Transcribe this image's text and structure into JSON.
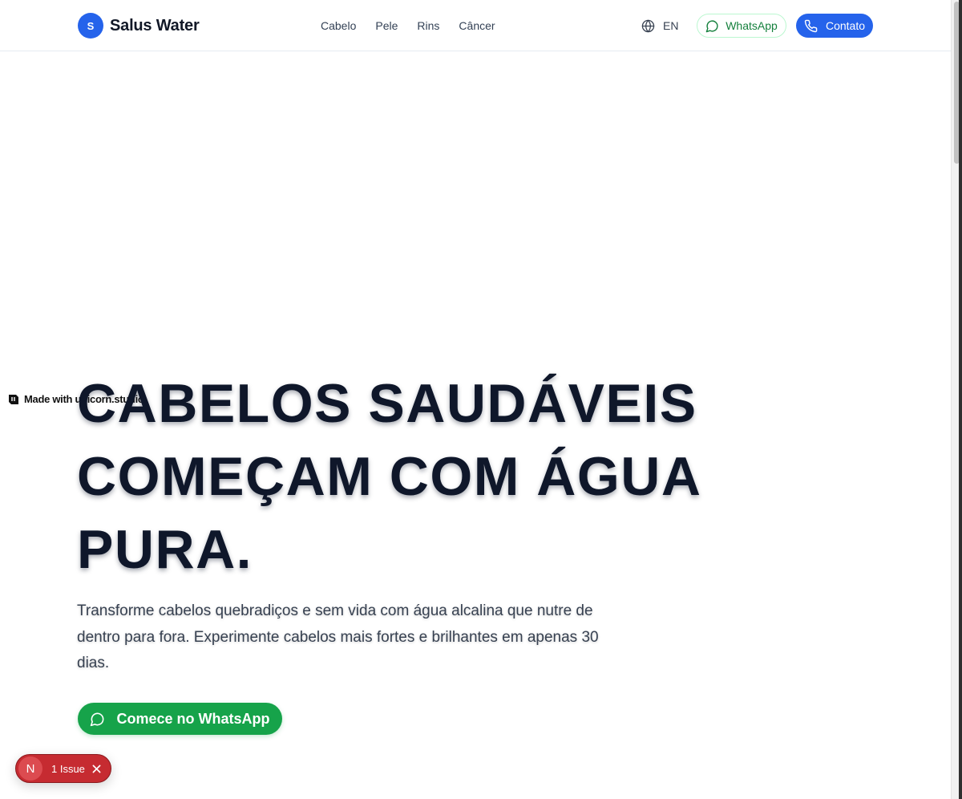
{
  "header": {
    "logo_letter": "S",
    "logo_text": "Salus Water",
    "nav": [
      {
        "label": "Cabelo"
      },
      {
        "label": "Pele"
      },
      {
        "label": "Rins"
      },
      {
        "label": "Câncer"
      }
    ],
    "language": {
      "label": "EN",
      "icon": "globe-icon"
    },
    "whatsapp_label": "WhatsApp",
    "contact_label": "Contato"
  },
  "hero": {
    "title_lines": [
      "CABELOS SAUDÁVEIS",
      "COMEÇAM COM ÁGUA",
      "PURA."
    ],
    "subtitle": "Transforme cabelos quebradiços e sem vida com água alcalina que nutre de dentro para fora. Experimente cabelos mais fortes e brilhantes em apenas 30 dias.",
    "cta_label": "Comece no WhatsApp"
  },
  "made_with": "Made with unicorn.studio",
  "issue_badge": {
    "letter": "N",
    "label": "1 Issue"
  },
  "colors": {
    "primary": "#2563eb",
    "whatsapp_green": "#16a34a",
    "title": "#0f172a",
    "issue_red": "#c62b31"
  }
}
